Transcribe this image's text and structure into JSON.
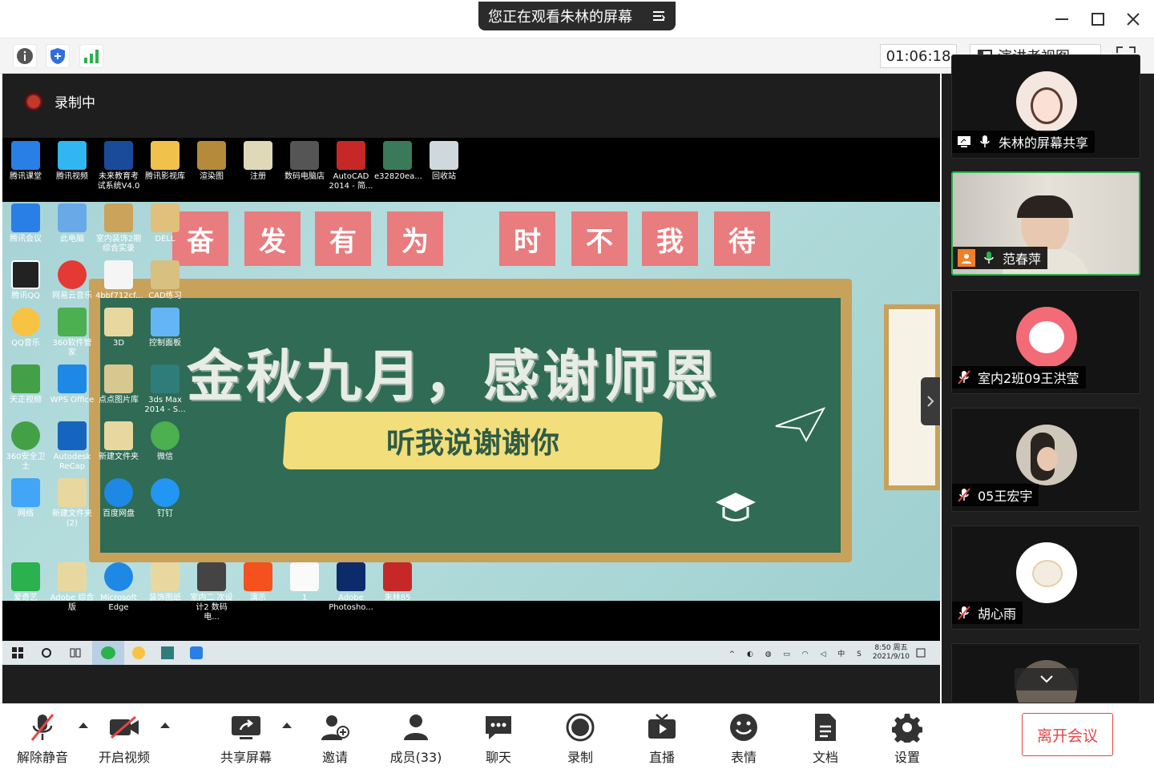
{
  "titlebar": {
    "share_notice": "您正在观看朱林的屏幕"
  },
  "toolbar": {
    "timer": "01:06:18",
    "view_mode": "演讲者视图"
  },
  "recording": {
    "label": "录制中"
  },
  "desktop": {
    "top_icons": [
      "腾讯课堂",
      "腾讯视频",
      "未来教育考试系统V4.0",
      "腾讯影视库",
      "渲染图",
      "注册",
      "数码电脑店",
      "AutoCAD 2014 - 简...",
      "e32820ea...",
      "回收站"
    ],
    "left_icons": [
      "腾讯会议",
      "此电脑",
      "室内装饰2期综合实录",
      "DELL",
      "腾讯QQ",
      "网易云音乐",
      "4bbf712cf...",
      "CAD练习",
      "QQ音乐",
      "360软件管家",
      "3D",
      "控制面板",
      "天正视频",
      "WPS Office",
      "点点图片库",
      "3ds Max 2014 - S...",
      "360安全卫士",
      "Autodesk ReCap",
      "新建文件夹",
      "微信",
      "网络",
      "新建文件夹 (2)",
      "百度网盘",
      "钉钉",
      "爱奇艺",
      "Adobe 综合版",
      "Microsoft Edge",
      "装饰图纸",
      "室内二 次设计2 数码电...",
      "演示",
      "1",
      "Adobe Photosho...",
      "朱林85"
    ],
    "banner_chars": [
      "奋",
      "发",
      "有",
      "为",
      "时",
      "不",
      "我",
      "待"
    ],
    "board_title": "金秋九月，感谢师恩",
    "ribbon_text": "听我说谢谢你",
    "clock_time": "8:50 周五",
    "clock_date": "2021/9/10"
  },
  "participants": [
    {
      "name": "朱林的屏幕共享",
      "status": "sharing"
    },
    {
      "name": "范春萍",
      "status": "speaking"
    },
    {
      "name": "室内2班09王洪莹",
      "status": "muted"
    },
    {
      "name": "05王宏宇",
      "status": "muted"
    },
    {
      "name": "胡心雨",
      "status": "muted"
    }
  ],
  "bottombar": {
    "unmute": "解除静音",
    "video": "开启视频",
    "share": "共享屏幕",
    "invite": "邀请",
    "members": "成员(33)",
    "chat": "聊天",
    "record": "录制",
    "live": "直播",
    "reactions": "表情",
    "docs": "文档",
    "settings": "设置",
    "leave": "离开会议"
  },
  "colors": {
    "accent_green": "#2bb14d",
    "leave_red": "#e64545",
    "banner_pink": "#e87c7e",
    "chalkboard": "#2f6b55"
  }
}
